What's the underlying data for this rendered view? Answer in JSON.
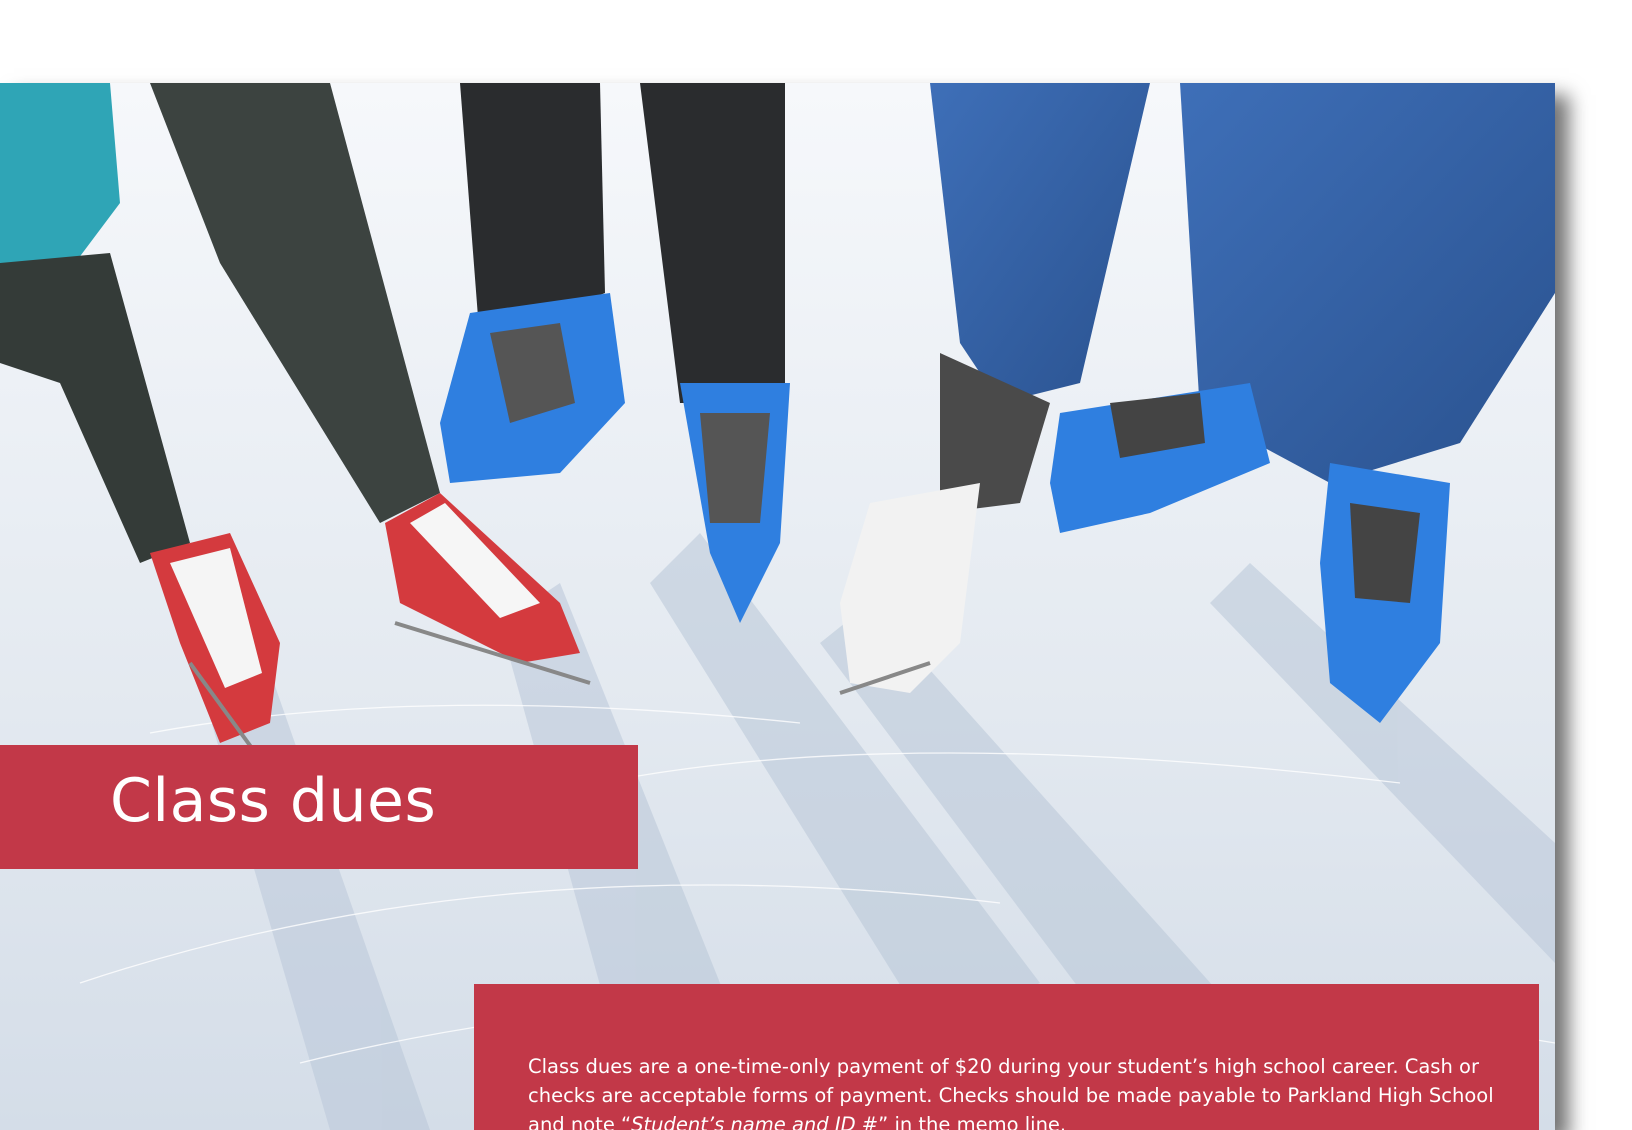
{
  "title": "Class dues",
  "body": {
    "part1": "Class dues are a one-time-only payment of $20 during your student’s high school career. Cash or checks are acceptable forms of payment. Checks should be made payable to Parkland High School and note “",
    "memo_italic": "Student’s name and ID #",
    "part2": "” in the memo line."
  },
  "photo": {
    "subject": "ice-skates-photo"
  },
  "colors": {
    "accent": "#c23848",
    "text_on_accent": "#ffffff",
    "page_background": "#ffffff"
  }
}
